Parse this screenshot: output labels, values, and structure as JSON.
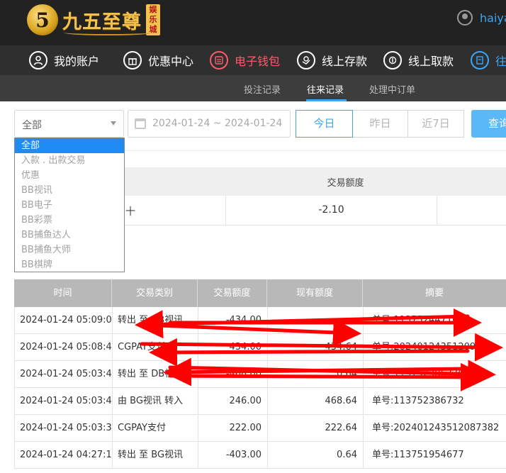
{
  "brand": {
    "logo_mark": "5",
    "name": "九五至尊",
    "tag": "娱乐城"
  },
  "user": {
    "name": "haiya"
  },
  "mainnav": {
    "items": [
      {
        "label": "我的账户",
        "icon": "user-icon"
      },
      {
        "label": "优惠中心",
        "icon": "gift-icon"
      },
      {
        "label": "电子钱包",
        "icon": "wallet-icon"
      },
      {
        "label": "线上存款",
        "icon": "deposit-icon"
      },
      {
        "label": "线上取款",
        "icon": "withdraw-icon"
      },
      {
        "label": "往",
        "icon": "record-icon"
      }
    ]
  },
  "subnav": {
    "items": [
      "投注记录",
      "往来记录",
      "处理中订单"
    ]
  },
  "filters": {
    "type_select": "全部",
    "date_range": "2024-01-24 ~ 2024-01-24",
    "quick": [
      "今日",
      "昨日",
      "近7日"
    ],
    "query": "查询"
  },
  "dropdown": {
    "options": [
      "全部",
      "入款 . 出款交易",
      "优惠",
      "BB视讯",
      "BB电子",
      "BB彩票",
      "BB捕鱼达人",
      "BB捕鱼大师",
      "BB棋牌"
    ]
  },
  "summary": {
    "header": "交易额度",
    "lead_fragment": "十",
    "amount": "-2.10"
  },
  "table": {
    "columns": [
      "时间",
      "交易类别",
      "交易额度",
      "现有额度",
      "摘要"
    ],
    "rows": [
      [
        "2024-01-24 05:09:01",
        "转出 至 DB视讯",
        "-434.00",
        "",
        "单号:113752447168"
      ],
      [
        "2024-01-24 05:08:49",
        "CGPAY支付",
        "434.00",
        "434.64",
        "单号:202401243512094"
      ],
      [
        "2024-01-24 05:03:46",
        "转出 至 DB视讯",
        "-468.00",
        "0.64",
        "单号:113752386770"
      ],
      [
        "2024-01-24 05:03:46",
        "由 BG视讯 转入",
        "246.00",
        "468.64",
        "单号:113752386732"
      ],
      [
        "2024-01-24 05:03:32",
        "CGPAY支付",
        "222.00",
        "222.64",
        "单号:202401243512087382"
      ],
      [
        "2024-01-24 04:27:19",
        "转出 至 BG视讯",
        "-403.00",
        "0.64",
        "单号:113751954677"
      ]
    ]
  },
  "colors": {
    "accent": "#3aa7f7",
    "active_nav": "#ff5a6c",
    "header_bg": "#222222",
    "annotation": "#ff0000"
  }
}
